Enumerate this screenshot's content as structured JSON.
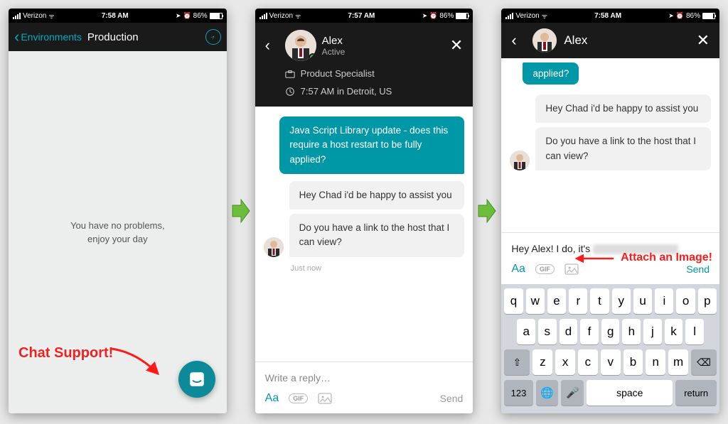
{
  "statusbar": {
    "carrier": "Verizon",
    "time_s1": "7:58 AM",
    "time_s2": "7:57 AM",
    "time_s3": "7:58 AM",
    "battery_pct": "86%"
  },
  "screen1": {
    "back_label": "Environments",
    "title": "Production",
    "empty_line1": "You have no problems,",
    "empty_line2": "enjoy your day"
  },
  "callouts": {
    "chat_support": "Chat Support!",
    "attach_image": "Attach an Image!"
  },
  "agent": {
    "name": "Alex",
    "status": "Active",
    "role": "Product Specialist",
    "local_time": "7:57 AM in Detroit, US"
  },
  "messages": {
    "user_q": "Java Script Library update - does this require a host restart to be fully applied?",
    "agent_1": "Hey Chad i'd be happy to assist you",
    "agent_2": "Do you have a link to the host that I can view?",
    "timestamp": "Just now",
    "peek": "applied?"
  },
  "compose": {
    "placeholder": "Write a reply…",
    "draft": "Hey Alex! I do, it's",
    "aa": "Aa",
    "gif": "GIF",
    "send": "Send"
  },
  "keyboard": {
    "row1": [
      "q",
      "w",
      "e",
      "r",
      "t",
      "y",
      "u",
      "i",
      "o",
      "p"
    ],
    "row2": [
      "a",
      "s",
      "d",
      "f",
      "g",
      "h",
      "j",
      "k",
      "l"
    ],
    "row3": [
      "z",
      "x",
      "c",
      "v",
      "b",
      "n",
      "m"
    ],
    "shift": "⇧",
    "backspace": "⌫",
    "k123": "123",
    "globe": "🌐",
    "mic": "🎤",
    "space": "space",
    "ret": "return"
  }
}
